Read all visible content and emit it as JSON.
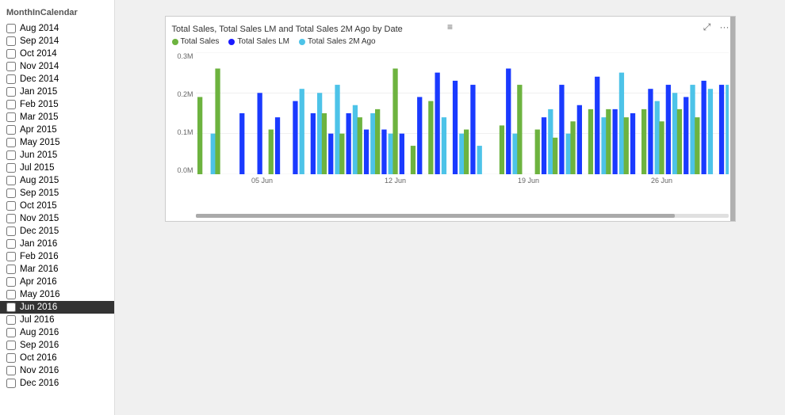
{
  "sidebar": {
    "header": "MonthInCalendar",
    "items": [
      {
        "label": "Aug 2014",
        "checked": false,
        "selected": false
      },
      {
        "label": "Sep 2014",
        "checked": false,
        "selected": false
      },
      {
        "label": "Oct 2014",
        "checked": false,
        "selected": false
      },
      {
        "label": "Nov 2014",
        "checked": false,
        "selected": false
      },
      {
        "label": "Dec 2014",
        "checked": false,
        "selected": false
      },
      {
        "label": "Jan 2015",
        "checked": false,
        "selected": false
      },
      {
        "label": "Feb 2015",
        "checked": false,
        "selected": false
      },
      {
        "label": "Mar 2015",
        "checked": false,
        "selected": false
      },
      {
        "label": "Apr 2015",
        "checked": false,
        "selected": false
      },
      {
        "label": "May 2015",
        "checked": false,
        "selected": false
      },
      {
        "label": "Jun 2015",
        "checked": false,
        "selected": false
      },
      {
        "label": "Jul 2015",
        "checked": false,
        "selected": false
      },
      {
        "label": "Aug 2015",
        "checked": false,
        "selected": false
      },
      {
        "label": "Sep 2015",
        "checked": false,
        "selected": false
      },
      {
        "label": "Oct 2015",
        "checked": false,
        "selected": false
      },
      {
        "label": "Nov 2015",
        "checked": false,
        "selected": false
      },
      {
        "label": "Dec 2015",
        "checked": false,
        "selected": false
      },
      {
        "label": "Jan 2016",
        "checked": false,
        "selected": false
      },
      {
        "label": "Feb 2016",
        "checked": false,
        "selected": false
      },
      {
        "label": "Mar 2016",
        "checked": false,
        "selected": false
      },
      {
        "label": "Apr 2016",
        "checked": false,
        "selected": false
      },
      {
        "label": "May 2016",
        "checked": false,
        "selected": false
      },
      {
        "label": "Jun 2016",
        "checked": false,
        "selected": true
      },
      {
        "label": "Jul 2016",
        "checked": false,
        "selected": false
      },
      {
        "label": "Aug 2016",
        "checked": false,
        "selected": false
      },
      {
        "label": "Sep 2016",
        "checked": false,
        "selected": false
      },
      {
        "label": "Oct 2016",
        "checked": false,
        "selected": false
      },
      {
        "label": "Nov 2016",
        "checked": false,
        "selected": false
      },
      {
        "label": "Dec 2016",
        "checked": false,
        "selected": false
      }
    ]
  },
  "chart": {
    "title": "Total Sales, Total Sales LM and Total Sales 2M Ago by Date",
    "legend": [
      {
        "label": "Total Sales",
        "color": "#6db33f"
      },
      {
        "label": "Total Sales LM",
        "color": "#1a1aff"
      },
      {
        "label": "Total Sales 2M Ago",
        "color": "#4dc3e8"
      }
    ],
    "yLabels": [
      "0.3M",
      "0.2M",
      "0.1M",
      "0.0M"
    ],
    "xLabels": [
      "05 Jun",
      "12 Jun",
      "19 Jun",
      "26 Jun"
    ],
    "bars": [
      {
        "date": 1,
        "s": 0.19,
        "lm": 0.0,
        "ma": 0.1
      },
      {
        "date": 2,
        "s": 0.26,
        "lm": 0.0,
        "ma": 0.0
      },
      {
        "date": 3,
        "s": 0.0,
        "lm": 0.15,
        "ma": 0.0
      },
      {
        "date": 4,
        "s": 0.0,
        "lm": 0.2,
        "ma": 0.0
      },
      {
        "date": 5,
        "s": 0.11,
        "lm": 0.14,
        "ma": 0.0
      },
      {
        "date": 6,
        "s": 0.0,
        "lm": 0.18,
        "ma": 0.21
      },
      {
        "date": 7,
        "s": 0.0,
        "lm": 0.15,
        "ma": 0.2
      },
      {
        "date": 8,
        "s": 0.15,
        "lm": 0.1,
        "ma": 0.22
      },
      {
        "date": 9,
        "s": 0.1,
        "lm": 0.15,
        "ma": 0.17
      },
      {
        "date": 10,
        "s": 0.14,
        "lm": 0.11,
        "ma": 0.15
      },
      {
        "date": 11,
        "s": 0.16,
        "lm": 0.11,
        "ma": 0.1
      },
      {
        "date": 12,
        "s": 0.26,
        "lm": 0.1,
        "ma": 0.0
      },
      {
        "date": 13,
        "s": 0.07,
        "lm": 0.19,
        "ma": 0.0
      },
      {
        "date": 14,
        "s": 0.18,
        "lm": 0.25,
        "ma": 0.14
      },
      {
        "date": 15,
        "s": 0.0,
        "lm": 0.23,
        "ma": 0.1
      },
      {
        "date": 16,
        "s": 0.11,
        "lm": 0.22,
        "ma": 0.07
      },
      {
        "date": 17,
        "s": 0.0,
        "lm": 0.0,
        "ma": 0.0
      },
      {
        "date": 18,
        "s": 0.12,
        "lm": 0.26,
        "ma": 0.1
      },
      {
        "date": 19,
        "s": 0.22,
        "lm": 0.0,
        "ma": 0.0
      },
      {
        "date": 20,
        "s": 0.11,
        "lm": 0.14,
        "ma": 0.16
      },
      {
        "date": 21,
        "s": 0.09,
        "lm": 0.22,
        "ma": 0.1
      },
      {
        "date": 22,
        "s": 0.13,
        "lm": 0.17,
        "ma": 0.0
      },
      {
        "date": 23,
        "s": 0.16,
        "lm": 0.24,
        "ma": 0.14
      },
      {
        "date": 24,
        "s": 0.16,
        "lm": 0.16,
        "ma": 0.25
      },
      {
        "date": 25,
        "s": 0.14,
        "lm": 0.15,
        "ma": 0.0
      },
      {
        "date": 26,
        "s": 0.16,
        "lm": 0.21,
        "ma": 0.18
      },
      {
        "date": 27,
        "s": 0.13,
        "lm": 0.22,
        "ma": 0.2
      },
      {
        "date": 28,
        "s": 0.16,
        "lm": 0.19,
        "ma": 0.22
      },
      {
        "date": 29,
        "s": 0.14,
        "lm": 0.23,
        "ma": 0.21
      },
      {
        "date": 30,
        "s": 0.0,
        "lm": 0.22,
        "ma": 0.22
      }
    ],
    "colors": {
      "totalSales": "#6db33f",
      "totalSalesLM": "#1a3aff",
      "totalSales2M": "#4dc3e8"
    }
  },
  "toolbar": {
    "hamburger": "≡",
    "expand": "⤢",
    "more": "···"
  }
}
